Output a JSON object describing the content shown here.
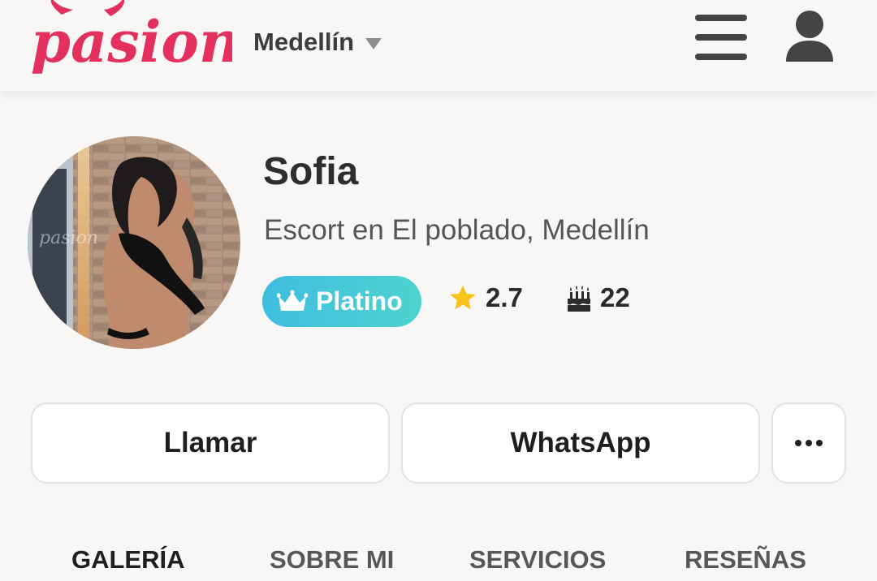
{
  "header": {
    "logo_text": "pasion",
    "city": "Medellín"
  },
  "profile": {
    "name": "Sofia",
    "subtitle": "Escort en El poblado, Medellín",
    "photo_watermark": "pasion",
    "badge_label": "Platino",
    "rating": "2.7",
    "age": "22"
  },
  "actions": {
    "call_label": "Llamar",
    "whatsapp_label": "WhatsApp"
  },
  "tabs": [
    {
      "label": "GALERÍA",
      "active": true
    },
    {
      "label": "SOBRE MI"
    },
    {
      "label": "SERVICIOS"
    },
    {
      "label": "RESEÑAS"
    }
  ],
  "colors": {
    "brand": "#e3305c",
    "badge_start": "#3fbde0",
    "badge_end": "#4ed3cf",
    "star": "#f7c21b"
  },
  "icons": [
    "logo-devil-horns",
    "caret-down-icon",
    "hamburger-menu-icon",
    "user-icon",
    "crown-icon",
    "star-icon",
    "birthday-cake-icon",
    "more-dots-icon"
  ]
}
